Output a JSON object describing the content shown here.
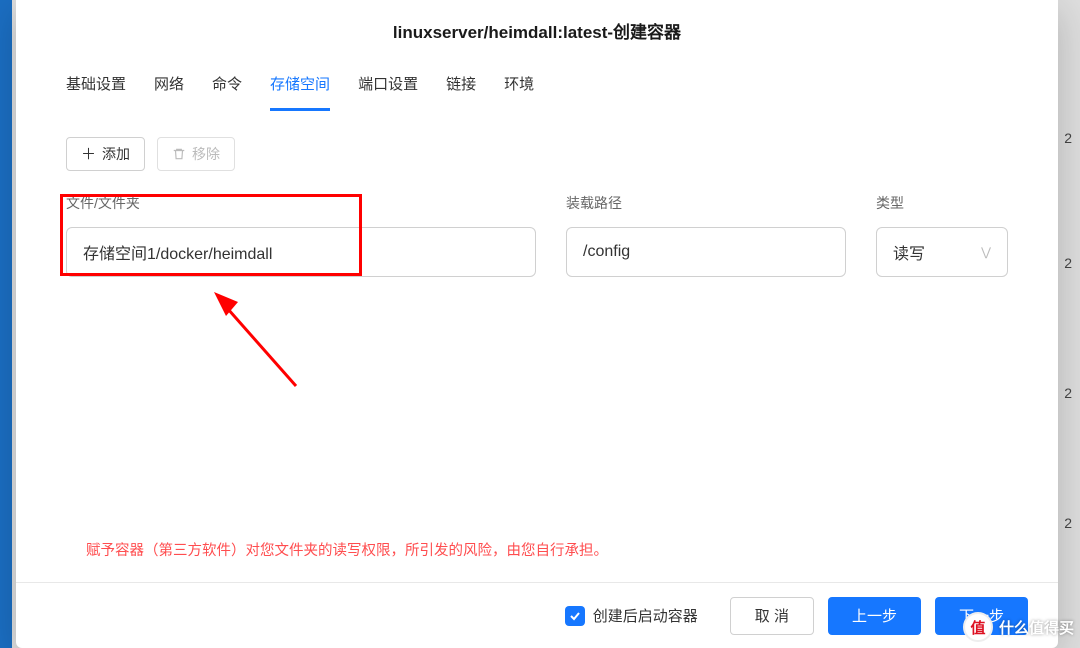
{
  "backdrop_numbers": [
    "2",
    "2",
    "2",
    "2"
  ],
  "modal": {
    "title": "linuxserver/heimdall:latest-创建容器",
    "tabs": [
      "基础设置",
      "网络",
      "命令",
      "存储空间",
      "端口设置",
      "链接",
      "环境"
    ],
    "active_tab_index": 3,
    "toolbar": {
      "add_label": "添加",
      "remove_label": "移除"
    },
    "columns": {
      "file_folder": "文件/文件夹",
      "mount_path": "装载路径",
      "type": "类型"
    },
    "row": {
      "file_value": "存储空间1/docker/heimdall",
      "mount_value": "/config",
      "type_value": "读写"
    },
    "warning": "赋予容器（第三方软件）对您文件夹的读写权限，所引发的风险，由您自行承担。",
    "footer": {
      "checkbox_label": "创建后启动容器",
      "cancel": "取 消",
      "prev": "上一步",
      "next": "下一步"
    }
  },
  "watermark": "什么值得买"
}
